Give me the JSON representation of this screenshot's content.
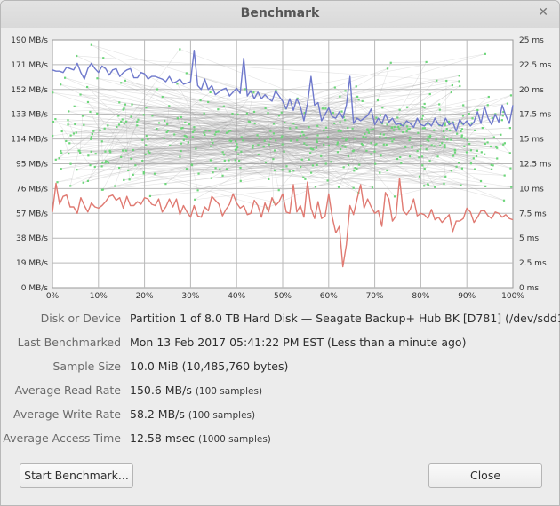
{
  "window": {
    "title": "Benchmark"
  },
  "chart_data": {
    "type": "line",
    "x_ticks": [
      "0%",
      "10%",
      "20%",
      "30%",
      "40%",
      "50%",
      "60%",
      "70%",
      "80%",
      "90%",
      "100%"
    ],
    "y_left_ticks": [
      "0 MB/s",
      "19 MB/s",
      "38 MB/s",
      "57 MB/s",
      "76 MB/s",
      "95 MB/s",
      "114 MB/s",
      "133 MB/s",
      "152 MB/s",
      "171 MB/s",
      "190 MB/s"
    ],
    "y_right_ticks": [
      "0 ms",
      "2.5 ms",
      "5 ms",
      "7.5 ms",
      "10 ms",
      "12.5 ms",
      "15 ms",
      "17.5 ms",
      "20 ms",
      "22.5 ms",
      "25 ms"
    ],
    "xlim": [
      0,
      100
    ],
    "ylim_left": [
      0,
      190
    ],
    "ylim_right": [
      0,
      25
    ],
    "grid": true,
    "series": [
      {
        "color": "#6f79cc",
        "axis": "left",
        "values": [
          167,
          166,
          166,
          165,
          169,
          168,
          167,
          172,
          165,
          160,
          168,
          172,
          168,
          165,
          170,
          168,
          163,
          167,
          168,
          162,
          165,
          167,
          168,
          161,
          161,
          165,
          164,
          160,
          162,
          162,
          161,
          160,
          158,
          162,
          157,
          158,
          160,
          156,
          157,
          158,
          182,
          155,
          152,
          160,
          152,
          155,
          148,
          150,
          152,
          153,
          147,
          150,
          153,
          149,
          176,
          147,
          151,
          145,
          150,
          145,
          148,
          145,
          143,
          151,
          147,
          143,
          137,
          145,
          136,
          145,
          139,
          128,
          141,
          162,
          140,
          142,
          128,
          133,
          138,
          131,
          130,
          135,
          130,
          140,
          162,
          126,
          130,
          128,
          130,
          132,
          137,
          125,
          130,
          126,
          133,
          127,
          130,
          125,
          126,
          124,
          128,
          126,
          123,
          130,
          125,
          124,
          127,
          124,
          130,
          125,
          124,
          130,
          125,
          127,
          120,
          129,
          125,
          128,
          124,
          127,
          135,
          126,
          139,
          130,
          125,
          133,
          127,
          140,
          132,
          126,
          140
        ],
        "name": ""
      },
      {
        "color": "#e07a72",
        "axis": "left",
        "values": [
          58,
          80,
          64,
          70,
          71,
          62,
          62,
          57,
          69,
          63,
          58,
          65,
          62,
          61,
          63,
          66,
          70,
          71,
          67,
          69,
          61,
          70,
          63,
          63,
          66,
          64,
          69,
          68,
          64,
          63,
          68,
          58,
          62,
          68,
          62,
          68,
          56,
          63,
          58,
          54,
          63,
          55,
          54,
          62,
          59,
          70,
          67,
          64,
          55,
          60,
          64,
          72,
          65,
          61,
          63,
          56,
          57,
          67,
          63,
          54,
          65,
          58,
          69,
          63,
          66,
          72,
          58,
          57,
          79,
          58,
          63,
          54,
          81,
          61,
          53,
          66,
          53,
          55,
          72,
          54,
          42,
          47,
          16,
          33,
          63,
          56,
          68,
          79,
          61,
          68,
          62,
          57,
          59,
          47,
          73,
          68,
          51,
          55,
          84,
          59,
          56,
          60,
          68,
          55,
          57,
          56,
          53,
          60,
          52,
          54,
          50,
          53,
          56,
          43,
          51,
          51,
          53,
          61,
          58,
          50,
          54,
          59,
          59,
          55,
          53,
          58,
          57,
          54,
          56,
          53,
          52
        ],
        "name": ""
      },
      {
        "color": "#6dd67a",
        "axis": "right",
        "type": "scatter",
        "values": []
      }
    ]
  },
  "info": {
    "rows": [
      {
        "label": "Disk or Device",
        "value": "Partition 1 of 8.0 TB Hard Disk — Seagate Backup+ Hub BK [D781] (/dev/sdd1)",
        "note": ""
      },
      {
        "label": "Last Benchmarked",
        "value": "Mon 13 Feb 2017 05:41:22 PM EST (Less than a minute ago)",
        "note": ""
      },
      {
        "label": "Sample Size",
        "value": "10.0 MiB (10,485,760 bytes)",
        "note": ""
      },
      {
        "label": "Average Read Rate",
        "value": "150.6 MB/s",
        "note": "(100 samples)"
      },
      {
        "label": "Average Write Rate",
        "value": "58.2 MB/s",
        "note": "(100 samples)"
      },
      {
        "label": "Average Access Time",
        "value": "12.58 msec",
        "note": "(1000 samples)"
      }
    ]
  },
  "buttons": {
    "start_label": "Start Benchmark...",
    "close_label": "Close"
  }
}
